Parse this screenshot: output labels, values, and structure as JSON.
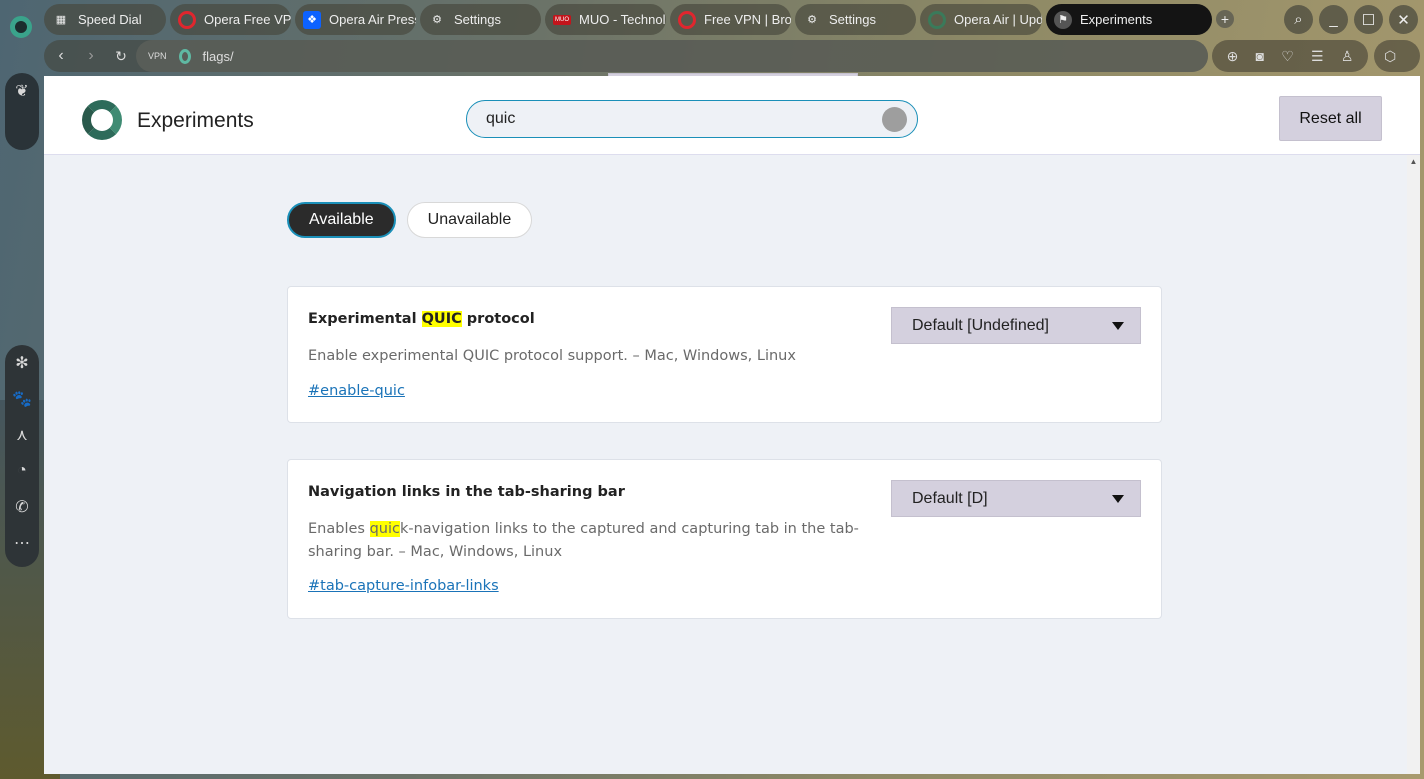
{
  "tabs": [
    {
      "label": "Speed Dial",
      "icon": "grid-icon"
    },
    {
      "label": "Opera Free VPN",
      "icon": "opera-icon"
    },
    {
      "label": "Opera Air Press",
      "icon": "dropbox-icon"
    },
    {
      "label": "Settings",
      "icon": "gear-icon"
    },
    {
      "label": "MUO - Technolo",
      "icon": "muo-icon"
    },
    {
      "label": "Free VPN | Brow",
      "icon": "opera-icon"
    },
    {
      "label": "Settings",
      "icon": "gear-icon"
    },
    {
      "label": "Opera Air | Upd",
      "icon": "opera-air-icon"
    },
    {
      "label": "Experiments",
      "icon": "flag-icon",
      "active": true
    }
  ],
  "address": {
    "vpn": "VPN",
    "url": "flags/"
  },
  "header": {
    "title": "Experiments",
    "search_value": "quic",
    "reset_label": "Reset all"
  },
  "filters": {
    "available": "Available",
    "unavailable": "Unavailable"
  },
  "flags": [
    {
      "title_pre": "Experimental ",
      "title_mark": "QUIC",
      "title_post": " protocol",
      "desc_pre": "Enable experimental QUIC protocol support. – Mac, Windows, Linux",
      "desc_mark": "",
      "desc_post": "",
      "link": "#enable-quic",
      "value": "Default [Undefined]"
    },
    {
      "title_pre": "Navigation links in the tab-sharing bar",
      "title_mark": "",
      "title_post": "",
      "desc_pre": "Enables ",
      "desc_mark": "quic",
      "desc_post": "k-navigation links to the captured and capturing tab in the tab-sharing bar. – Mac, Windows, Linux",
      "link": "#tab-capture-infobar-links",
      "value": "Default [D]"
    }
  ]
}
